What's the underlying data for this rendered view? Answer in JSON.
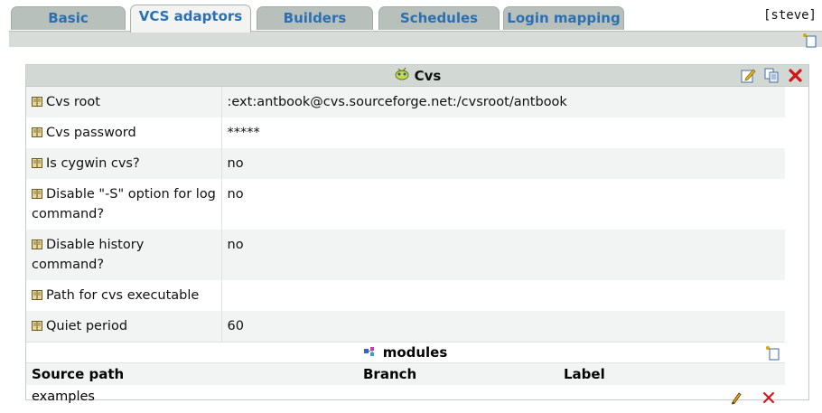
{
  "tabs": [
    {
      "label": "Basic",
      "active": false
    },
    {
      "label": "VCS adaptors",
      "active": true
    },
    {
      "label": "Builders",
      "active": false
    },
    {
      "label": "Schedules",
      "active": false
    },
    {
      "label": "Login mapping",
      "active": false
    }
  ],
  "user": "[steve]",
  "panel": {
    "title": "Cvs",
    "properties": [
      {
        "label": "Cvs root",
        "value": ":ext:antbook@cvs.sourceforge.net:/cvsroot/antbook"
      },
      {
        "label": "Cvs password",
        "value": "*****"
      },
      {
        "label": "Is cygwin cvs?",
        "value": "no"
      },
      {
        "label": "Disable \"-S\" option for log command?",
        "value": "no"
      },
      {
        "label": "Disable history command?",
        "value": "no"
      },
      {
        "label": "Path for cvs executable",
        "value": ""
      },
      {
        "label": "Quiet period",
        "value": "60"
      }
    ],
    "modules": {
      "title": "modules",
      "columns": [
        "Source path",
        "Branch",
        "Label"
      ],
      "rows": [
        {
          "source_path": "examples",
          "branch": "",
          "label": ""
        }
      ]
    }
  },
  "colors": {
    "tab_text": "#2b6fb5",
    "tab_bg": "#b7c0bb",
    "header_bg": "#d2d8d4",
    "delete_red": "#d21414"
  },
  "icons": [
    "cvs-component-icon",
    "edit-icon",
    "copy-icon",
    "delete-icon",
    "add-icon",
    "book-icon",
    "modules-icon",
    "pencil-icon"
  ]
}
